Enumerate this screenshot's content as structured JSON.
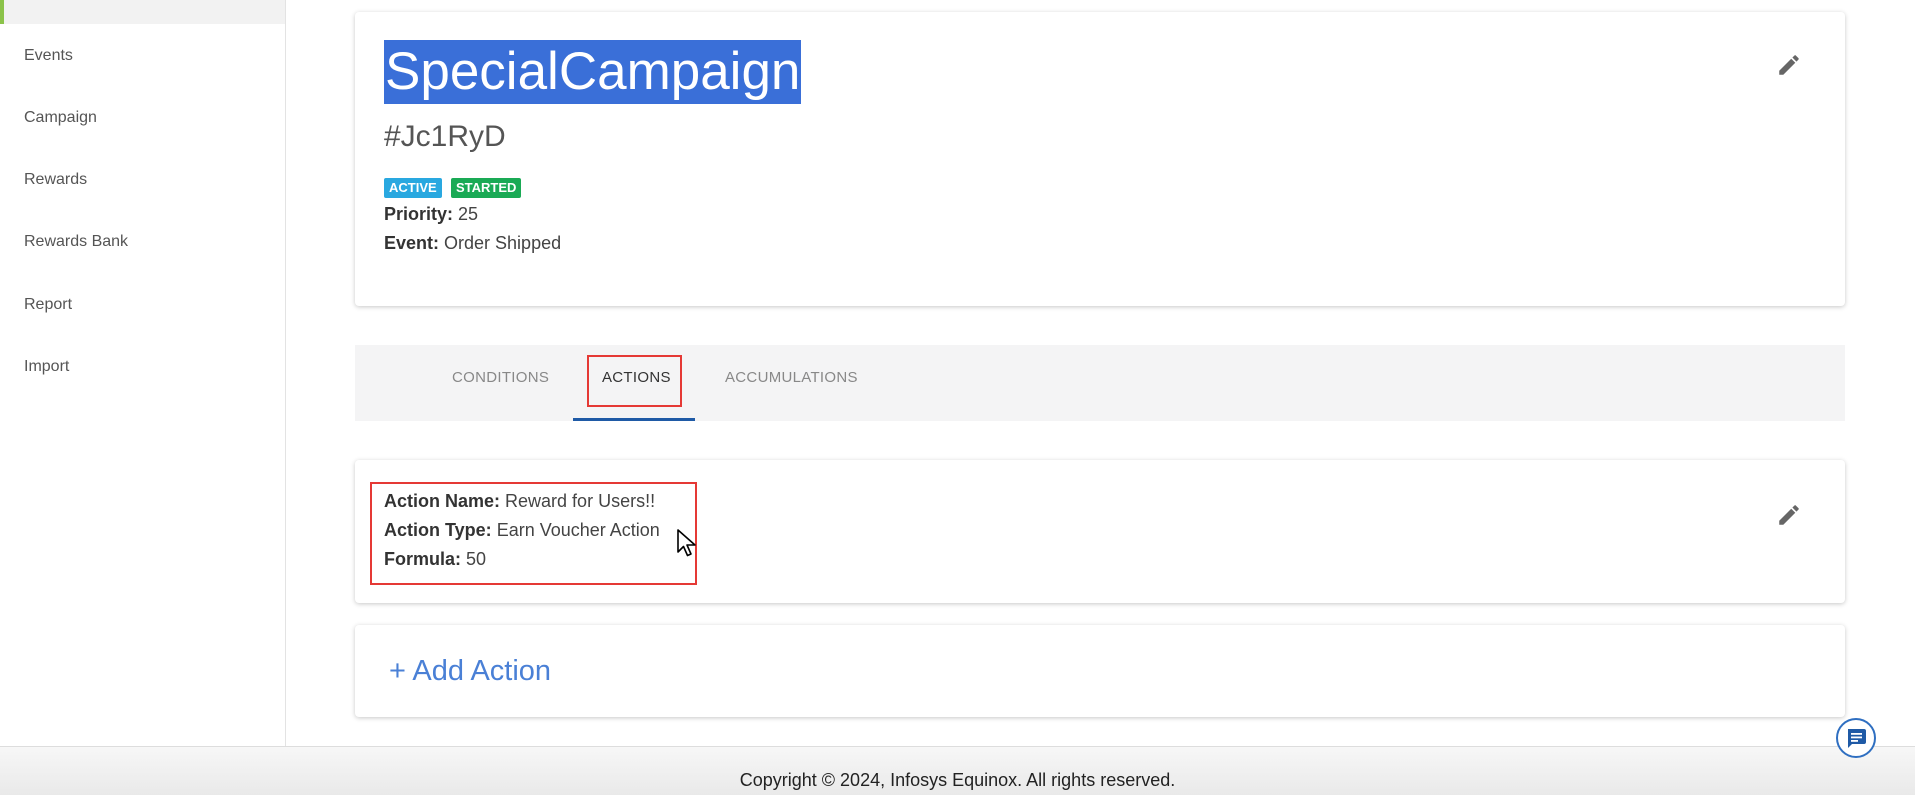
{
  "sidebar": {
    "items": [
      {
        "label": "Events"
      },
      {
        "label": "Campaign"
      },
      {
        "label": "Rewards"
      },
      {
        "label": "Rewards Bank"
      },
      {
        "label": "Report"
      },
      {
        "label": "Import"
      }
    ]
  },
  "campaign": {
    "title": "SpecialCampaign",
    "code": "#Jc1RyD",
    "badges": [
      {
        "label": "ACTIVE",
        "color": "#29a8e0"
      },
      {
        "label": "STARTED",
        "color": "#1aaa55"
      }
    ],
    "priority_label": "Priority:",
    "priority_value": "25",
    "event_label": "Event:",
    "event_value": "Order Shipped"
  },
  "tabs": [
    {
      "label": "CONDITIONS"
    },
    {
      "label": "ACTIONS",
      "active": true
    },
    {
      "label": "ACCUMULATIONS"
    }
  ],
  "action": {
    "name_label": "Action Name:",
    "name_value": "Reward for Users!!",
    "type_label": "Action Type:",
    "type_value": "Earn Voucher Action",
    "formula_label": "Formula:",
    "formula_value": "50"
  },
  "add_action": {
    "plus": "+",
    "label": "Add Action"
  },
  "footer": {
    "copyright": "Copyright © 2024, Infosys Equinox. All rights reserved."
  },
  "icons": {
    "edit": "pencil-icon",
    "chat": "chat-icon",
    "cursor": "mouse-pointer-icon"
  },
  "colors": {
    "accent": "#3a6fd8",
    "highlight": "#e53935",
    "tab_underline": "#1f5aa6",
    "link": "#4a80d6"
  }
}
